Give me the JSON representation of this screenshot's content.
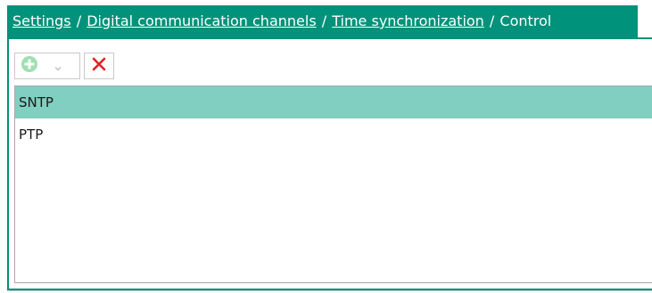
{
  "breadcrumb": {
    "items": [
      {
        "label": "Settings",
        "link": true
      },
      {
        "label": "Digital communication channels",
        "link": true
      },
      {
        "label": "Time synchronization",
        "link": true
      },
      {
        "label": "Control",
        "link": false
      }
    ],
    "separator": "/"
  },
  "toolbar": {
    "add_icon": "add-circle-icon",
    "dropdown_icon": "chevron-down-icon",
    "delete_icon": "close-x-icon"
  },
  "list": {
    "items": [
      {
        "label": "SNTP",
        "selected": true
      },
      {
        "label": "PTP",
        "selected": false
      }
    ]
  },
  "colors": {
    "accent": "#00927a",
    "selected_row": "#80cfc0",
    "add_icon": "#9fdfb0",
    "delete_icon": "#e32020"
  }
}
